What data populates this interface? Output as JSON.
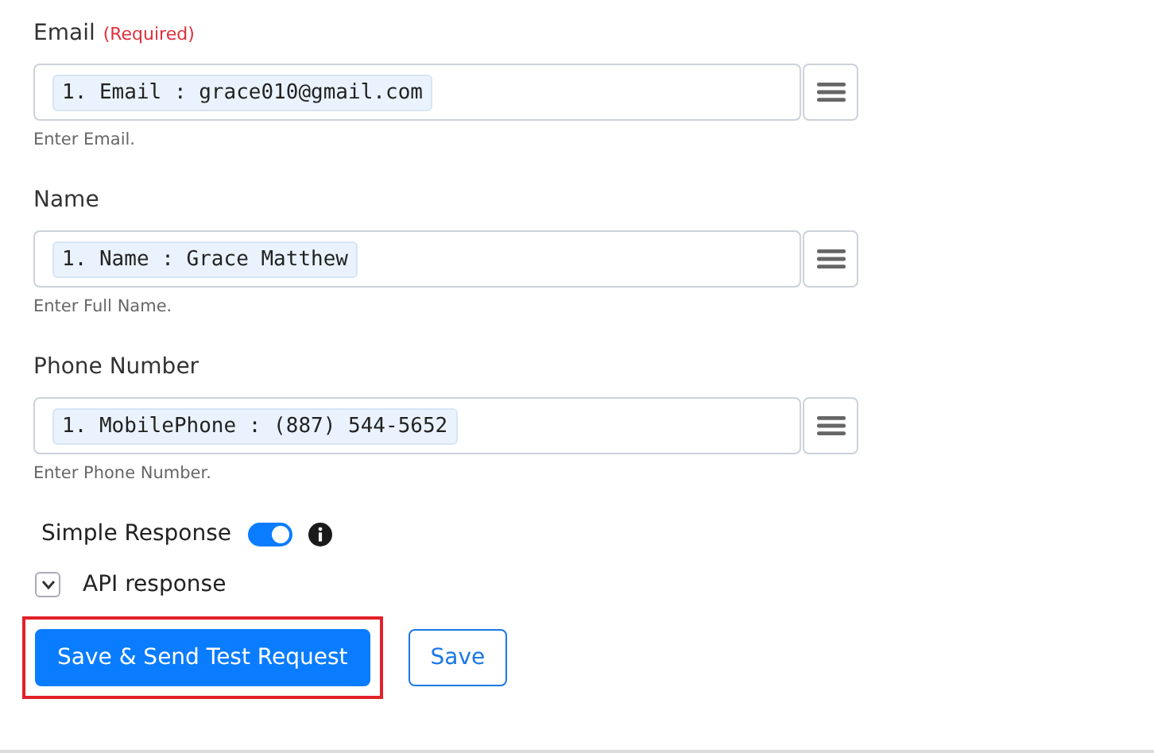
{
  "fields": [
    {
      "label": "Email",
      "required_note": "(Required)",
      "token": "1. Email : grace010@gmail.com",
      "hint": "Enter Email."
    },
    {
      "label": "Name",
      "token": "1. Name : Grace Matthew",
      "hint": "Enter Full Name."
    },
    {
      "label": "Phone Number",
      "token": "1. MobilePhone : (887) 544-5652",
      "hint": "Enter Phone Number."
    }
  ],
  "simple_response": {
    "label": "Simple Response",
    "on": true
  },
  "api_response": {
    "label": "API response",
    "expanded": false
  },
  "buttons": [
    {
      "label": "Save & Send Test Request",
      "kind": "primary",
      "highlighted": true
    },
    {
      "label": "Save",
      "kind": "secondary",
      "highlighted": false
    }
  ]
}
